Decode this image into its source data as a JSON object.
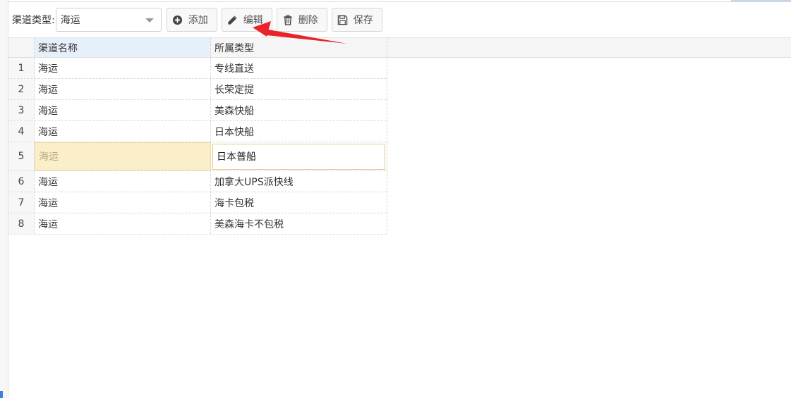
{
  "toolbar": {
    "channel_type_label": "渠道类型:",
    "channel_type_value": "海运",
    "buttons": {
      "add": "添加",
      "edit": "编辑",
      "delete": "删除",
      "save": "保存"
    }
  },
  "grid": {
    "columns": {
      "name": "渠道名称",
      "type": "所属类型"
    },
    "rows": [
      {
        "idx": "1",
        "name": "海运",
        "type": "专线直送"
      },
      {
        "idx": "2",
        "name": "海运",
        "type": "长荣定提"
      },
      {
        "idx": "3",
        "name": "海运",
        "type": "美森快船"
      },
      {
        "idx": "4",
        "name": "海运",
        "type": "日本快船"
      },
      {
        "idx": "5",
        "name": "海运",
        "type": "日本普船"
      },
      {
        "idx": "6",
        "name": "海运",
        "type": "加拿大UPS派快线"
      },
      {
        "idx": "7",
        "name": "海运",
        "type": "海卡包税"
      },
      {
        "idx": "8",
        "name": "海运",
        "type": "美森海卡不包税"
      }
    ],
    "editing_row": 5
  },
  "icons": {
    "add": "plus-circle-icon",
    "edit": "pencil-icon",
    "delete": "trash-icon",
    "save": "floppy-disk-icon",
    "combo_caret": "chevron-down-icon"
  },
  "colors": {
    "annotation_arrow": "#e8232a",
    "header_selected": "#e6f0fb",
    "editing_cell": "#fbefc9"
  }
}
